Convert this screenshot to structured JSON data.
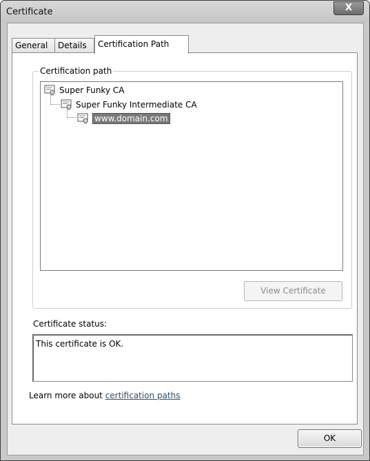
{
  "window": {
    "title": "Certificate",
    "close_glyph": "X"
  },
  "tabs": [
    {
      "label": "General"
    },
    {
      "label": "Details"
    },
    {
      "label": "Certification Path"
    }
  ],
  "certification_path": {
    "legend": "Certification path",
    "items": [
      {
        "label": "Super Funky CA",
        "icon": "certificate-icon"
      },
      {
        "label": "Super Funky Intermediate CA",
        "icon": "certificate-icon"
      },
      {
        "label": "www.domain.com",
        "icon": "certificate-icon",
        "selected": true
      }
    ],
    "view_button": "View Certificate"
  },
  "status": {
    "label": "Certificate status:",
    "text": "This certificate is OK."
  },
  "learn_more": {
    "prefix": "Learn more about ",
    "link": "certification paths"
  },
  "ok_button": "OK"
}
